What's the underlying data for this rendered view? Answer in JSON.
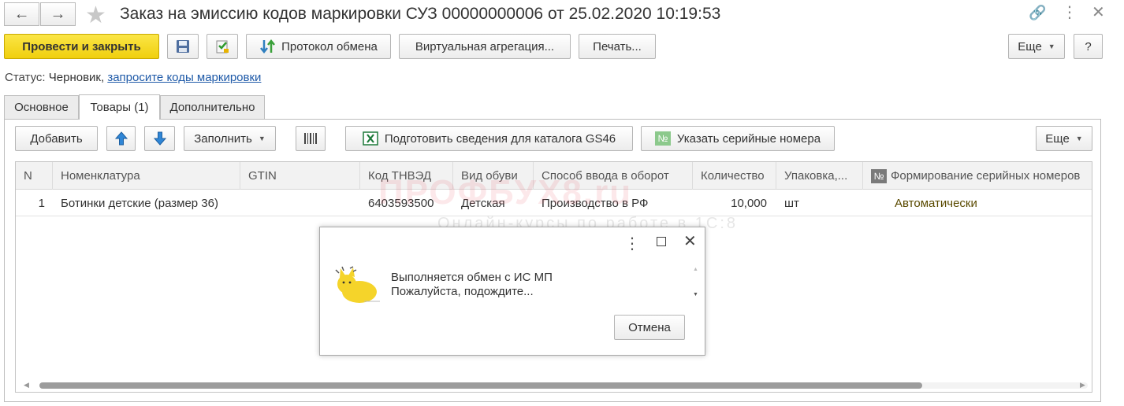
{
  "window": {
    "title": "Заказ на эмиссию кодов маркировки СУЗ 00000000006 от 25.02.2020 10:19:53"
  },
  "toolbar": {
    "post_close_label": "Провести и закрыть",
    "exchange_log_label": "Протокол обмена",
    "virtual_agg_label": "Виртуальная агрегация...",
    "print_label": "Печать...",
    "more_label": "Еще",
    "help_label": "?"
  },
  "status": {
    "prefix": "Статус:",
    "value": "Черновик,",
    "link": "запросите коды маркировки"
  },
  "tabs": [
    {
      "label": "Основное"
    },
    {
      "label": "Товары (1)"
    },
    {
      "label": "Дополнительно"
    }
  ],
  "goods_toolbar": {
    "add_label": "Добавить",
    "fill_label": "Заполнить",
    "gs46_label": "Подготовить сведения для каталога GS46",
    "serial_label": "Указать серийные номера",
    "more_label": "Еще"
  },
  "table": {
    "headers": [
      "N",
      "Номенклатура",
      "GTIN",
      "Код ТНВЭД",
      "Вид обуви",
      "Способ ввода в оборот",
      "Количество",
      "Упаковка,...",
      "Формирование серийных номеров"
    ],
    "rows": [
      [
        "1",
        "Ботинки детские (размер 36)",
        "",
        "6403593500",
        "Детская",
        "Производство в РФ",
        "10,000",
        "шт",
        "Автоматически"
      ]
    ]
  },
  "watermark": {
    "main": "ПРОФБУХ8.ru",
    "sub": "Онлайн-курсы по работе в 1С:8"
  },
  "dialog": {
    "message_line1": "Выполняется обмен с ИС МП",
    "message_line2": "Пожалуйста, подождите...",
    "cancel_label": "Отмена"
  },
  "colors": {
    "primary_button": "#f0cf0e",
    "link": "#1f5aa8",
    "mode_text": "#5a4a00"
  }
}
